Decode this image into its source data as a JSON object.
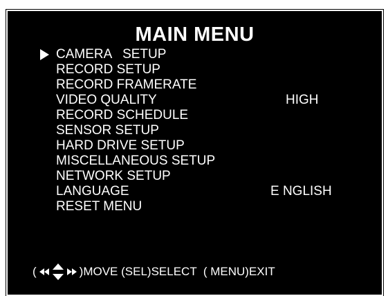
{
  "menu": {
    "title": "MAIN MENU",
    "items": [
      {
        "label": "CAMERA   SETUP",
        "value": ""
      },
      {
        "label": "RECORD SETUP",
        "value": ""
      },
      {
        "label": "RECORD FRAMERATE",
        "value": ""
      },
      {
        "label": "VIDEO QUALITY",
        "value": "HIGH"
      },
      {
        "label": "RECORD SCHEDULE",
        "value": ""
      },
      {
        "label": "SENSOR SETUP",
        "value": ""
      },
      {
        "label": "HARD DRIVE SETUP",
        "value": ""
      },
      {
        "label": "MISCELLANEOUS SETUP",
        "value": ""
      },
      {
        "label": "NETWORK SETUP",
        "value": ""
      },
      {
        "label": "LANGUAGE",
        "value": "E NGLISH"
      },
      {
        "label": "RESET MENU",
        "value": ""
      }
    ],
    "selected_index": 0
  },
  "footer": {
    "open_paren": "(",
    "move_text": ")MOVE (SEL)SELECT  ( MENU)EXIT",
    "nav_icon": "arrow-keys-icon"
  },
  "colors": {
    "background": "#000000",
    "text": "#ffffff"
  }
}
